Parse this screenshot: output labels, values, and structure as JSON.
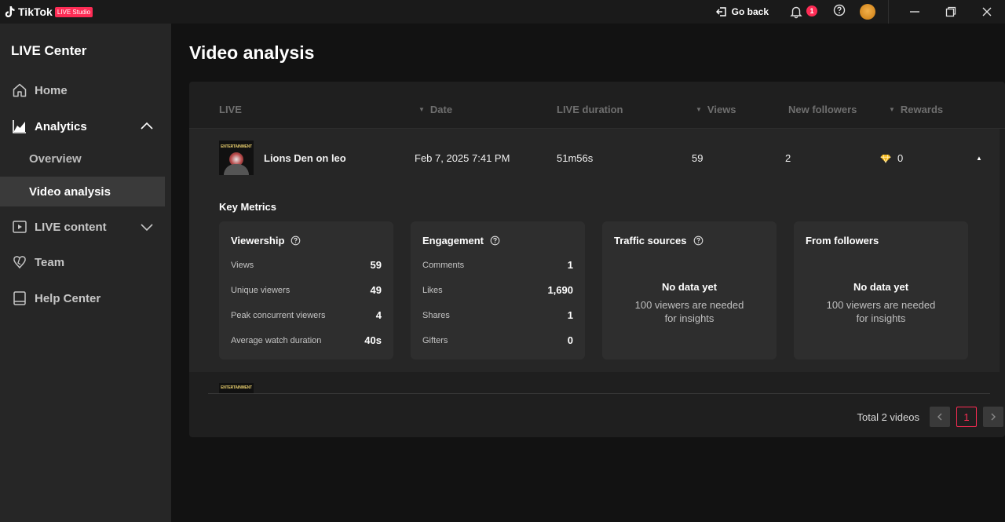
{
  "app": {
    "logo_text": "TikTok",
    "badge": "LIVE Studio",
    "go_back": "Go back",
    "notification_count": "1"
  },
  "sidebar": {
    "title": "LIVE Center",
    "items": [
      {
        "label": "Home",
        "icon": "home-icon"
      },
      {
        "label": "Analytics",
        "icon": "analytics-icon",
        "expanded": true
      },
      {
        "label": "LIVE content",
        "icon": "live-content-icon",
        "expanded": false
      },
      {
        "label": "Team",
        "icon": "team-icon"
      },
      {
        "label": "Help Center",
        "icon": "help-center-icon"
      }
    ],
    "analytics_sub": [
      {
        "label": "Overview",
        "selected": false
      },
      {
        "label": "Video analysis",
        "selected": true
      }
    ]
  },
  "page": {
    "title": "Video analysis"
  },
  "table": {
    "columns": [
      "LIVE",
      "Date",
      "LIVE duration",
      "Views",
      "New followers",
      "Rewards"
    ],
    "rows": [
      {
        "thumb_text": "ENTERTAINMENT",
        "title": "Lions Den on leo",
        "date": "Feb 7, 2025 7:41 PM",
        "duration": "51m56s",
        "views": "59",
        "new_followers": "2",
        "rewards": "0"
      },
      {
        "thumb_text": "ENTERTAINMENT"
      }
    ]
  },
  "key_metrics": {
    "title": "Key Metrics",
    "viewership": {
      "title": "Viewership",
      "rows": [
        {
          "label": "Views",
          "value": "59"
        },
        {
          "label": "Unique viewers",
          "value": "49"
        },
        {
          "label": "Peak concurrent viewers",
          "value": "4"
        },
        {
          "label": "Average watch duration",
          "value": "40s"
        }
      ]
    },
    "engagement": {
      "title": "Engagement",
      "rows": [
        {
          "label": "Comments",
          "value": "1"
        },
        {
          "label": "Likes",
          "value": "1,690"
        },
        {
          "label": "Shares",
          "value": "1"
        },
        {
          "label": "Gifters",
          "value": "0"
        }
      ]
    },
    "traffic_sources": {
      "title": "Traffic sources",
      "nodata_title": "No data yet",
      "nodata_line1": "100 viewers are needed",
      "nodata_line2": "for insights"
    },
    "from_followers": {
      "title": "From followers",
      "nodata_title": "No data yet",
      "nodata_line1": "100 viewers are needed",
      "nodata_line2": "for insights"
    }
  },
  "pagination": {
    "total": "Total 2 videos",
    "current_page": "1"
  },
  "colors": {
    "accent": "#fe2c55",
    "background": "#121212",
    "sidebar": "#262626",
    "card": "#1f1f1f"
  }
}
